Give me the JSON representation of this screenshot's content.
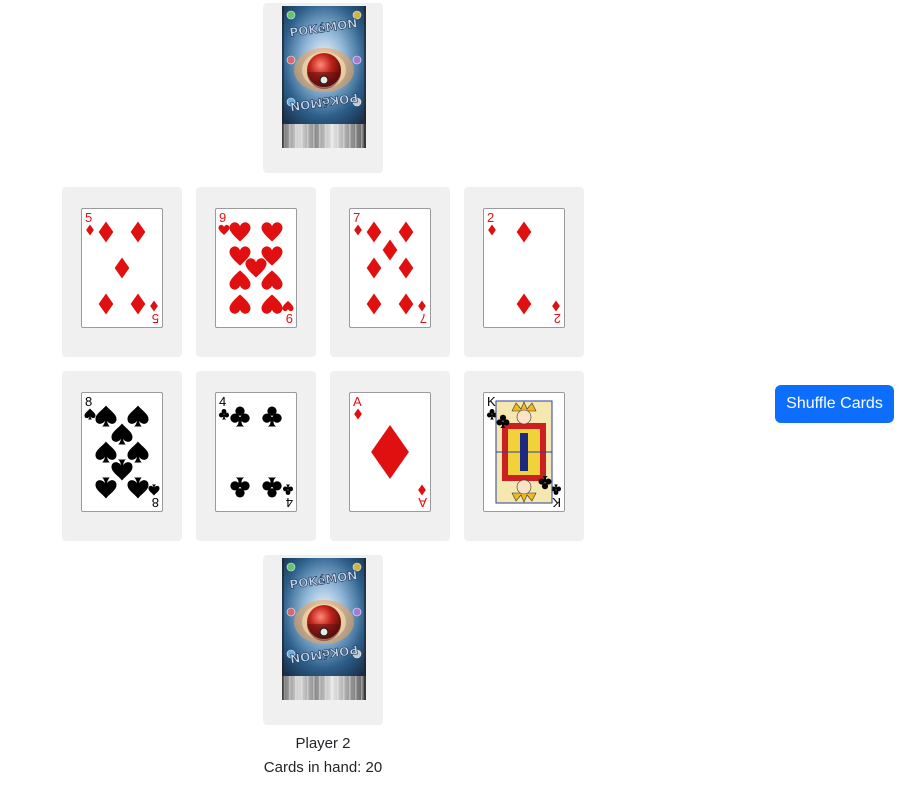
{
  "opponent": {
    "card_back": {
      "brand": "POKéMON"
    }
  },
  "table": {
    "rows": [
      [
        {
          "rank": "5",
          "suit": "diamonds",
          "color": "#e01010"
        },
        {
          "rank": "9",
          "suit": "hearts",
          "color": "#e01010"
        },
        {
          "rank": "7",
          "suit": "diamonds",
          "color": "#e01010"
        },
        {
          "rank": "2",
          "suit": "diamonds",
          "color": "#e01010"
        }
      ],
      [
        {
          "rank": "8",
          "suit": "spades",
          "color": "#000000"
        },
        {
          "rank": "4",
          "suit": "clubs",
          "color": "#000000"
        },
        {
          "rank": "A",
          "suit": "diamonds",
          "color": "#e01010"
        },
        {
          "rank": "K",
          "suit": "clubs",
          "color": "#000000"
        }
      ]
    ]
  },
  "player": {
    "card_back": {
      "brand": "POKéMON"
    },
    "name": "Player 2",
    "cards_in_hand": "Cards in hand: 20"
  },
  "controls": {
    "shuffle_label": "Shuffle Cards",
    "accent": "#0d6efd"
  }
}
